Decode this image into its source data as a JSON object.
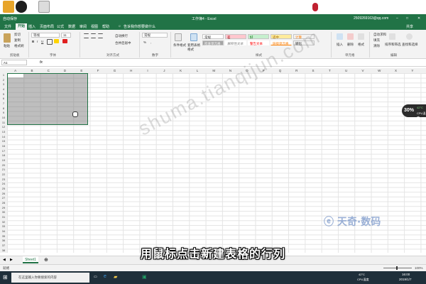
{
  "titlebar": {
    "left": "自动保存",
    "title": "工作簿4 - Excel",
    "account": "2509269163@qq.com"
  },
  "tabs": [
    "文件",
    "开始",
    "插入",
    "页面布局",
    "公式",
    "数据",
    "审阅",
    "视图",
    "帮助"
  ],
  "tell_me": "告诉我你想要做什么",
  "share": "共享",
  "ribbon": {
    "clipboard": {
      "paste": "粘贴",
      "cut": "剪切",
      "copy": "复制",
      "format_painter": "格式刷",
      "group": "剪贴板"
    },
    "font": {
      "name": "等线",
      "size": "11",
      "group": "字体"
    },
    "alignment": {
      "wrap": "自动换行",
      "merge": "合并后居中",
      "group": "对齐方式"
    },
    "number": {
      "format": "常规",
      "group": "数字"
    },
    "styles": {
      "conditional": "条件格式",
      "table": "套用表格格式",
      "cells": [
        {
          "label": "常规",
          "bg": "#ffffff",
          "fg": "#000000"
        },
        {
          "label": "差",
          "bg": "#ffc7ce",
          "fg": "#9c0006"
        },
        {
          "label": "好",
          "bg": "#c6efce",
          "fg": "#006100"
        },
        {
          "label": "适中",
          "bg": "#ffeb9c",
          "fg": "#9c6500"
        },
        {
          "label": "计算",
          "bg": "#f2f2f2",
          "fg": "#fa7d00"
        },
        {
          "label": "检查单元格",
          "bg": "#a5a5a5",
          "fg": "#ffffff"
        },
        {
          "label": "解释性文本",
          "bg": "#ffffff",
          "fg": "#7f7f7f"
        },
        {
          "label": "警告文本",
          "bg": "#ffffff",
          "fg": "#ff0000"
        },
        {
          "label": "链接单元格",
          "bg": "#ffffff",
          "fg": "#fa7d00"
        },
        {
          "label": "输出",
          "bg": "#f2f2f2",
          "fg": "#3f3f3f"
        }
      ],
      "group": "样式"
    },
    "cells_group": {
      "insert": "插入",
      "delete": "删除",
      "format": "格式",
      "group": "单元格"
    },
    "editing": {
      "autosum": "自动求和",
      "fill": "填充",
      "clear": "清除",
      "sort": "排序和筛选",
      "find": "查找和选择",
      "group": "编辑"
    }
  },
  "formula_bar": {
    "name_box": "A1",
    "fx": "fx",
    "value": ""
  },
  "columns": [
    "A",
    "B",
    "C",
    "D",
    "E",
    "F",
    "G",
    "H",
    "I",
    "J",
    "K",
    "L",
    "M",
    "N",
    "O",
    "P",
    "Q",
    "R",
    "S",
    "T",
    "U",
    "V",
    "W",
    "X",
    "Y",
    "Z"
  ],
  "row_count": 38,
  "sheet": {
    "tab": "Sheet1"
  },
  "status": {
    "left": "就绪",
    "zoom": "100%"
  },
  "taskbar": {
    "search": "在这里输入你要搜索的内容",
    "cpu_temp": "42°C",
    "cpu_label": "CPU温度",
    "time": "16:00",
    "date": "2019/1/7"
  },
  "overlay": {
    "watermark": "shuma.tianqijun.com",
    "subtitle": "用鼠标点击新建表格的行列",
    "logo": "天奇·数码"
  },
  "temp_widget": {
    "percent": "30%",
    "temp": "42°C",
    "label": "CPU温度"
  }
}
